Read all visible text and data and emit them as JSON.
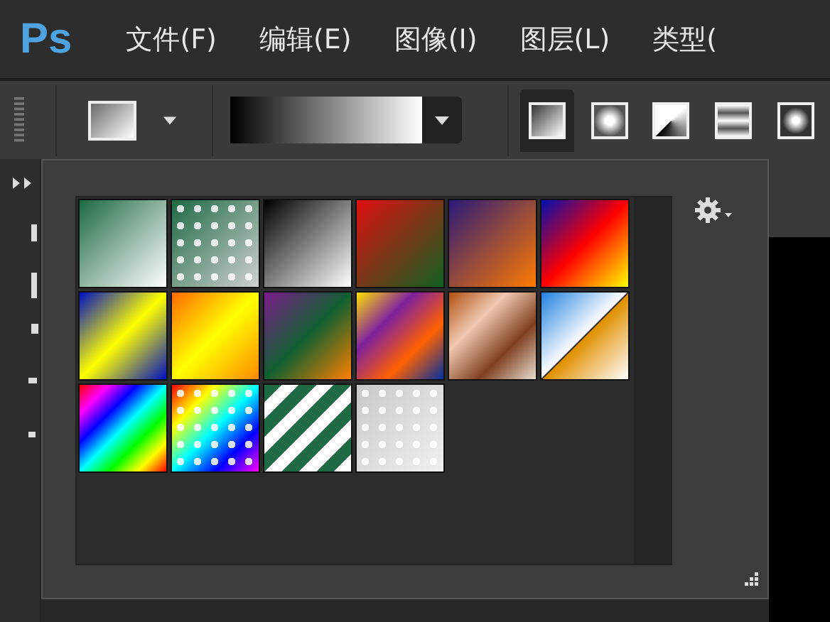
{
  "app": {
    "logo": "Ps"
  },
  "menu": [
    {
      "label": "文件(F)"
    },
    {
      "label": "编辑(E)"
    },
    {
      "label": "图像(I)"
    },
    {
      "label": "图层(L)"
    },
    {
      "label": "类型("
    }
  ],
  "options_bar": {
    "types": [
      {
        "kind": "linear",
        "selected": true
      },
      {
        "kind": "radial",
        "selected": false
      },
      {
        "kind": "angle",
        "selected": false
      },
      {
        "kind": "reflected",
        "selected": false
      },
      {
        "kind": "diamond",
        "selected": false
      }
    ]
  },
  "gradient_picker": {
    "swatches": [
      {
        "kind": "linear"
      },
      {
        "kind": "pattern"
      },
      {
        "kind": "linear"
      },
      {
        "kind": "linear"
      },
      {
        "kind": "linear"
      },
      {
        "kind": "linear"
      },
      {
        "kind": "linear"
      },
      {
        "kind": "linear"
      },
      {
        "kind": "linear"
      },
      {
        "kind": "linear"
      },
      {
        "kind": "linear"
      },
      {
        "kind": "split"
      },
      {
        "kind": "linear"
      },
      {
        "kind": "pattern"
      },
      {
        "kind": "stripes"
      },
      {
        "kind": "pattern"
      }
    ]
  }
}
